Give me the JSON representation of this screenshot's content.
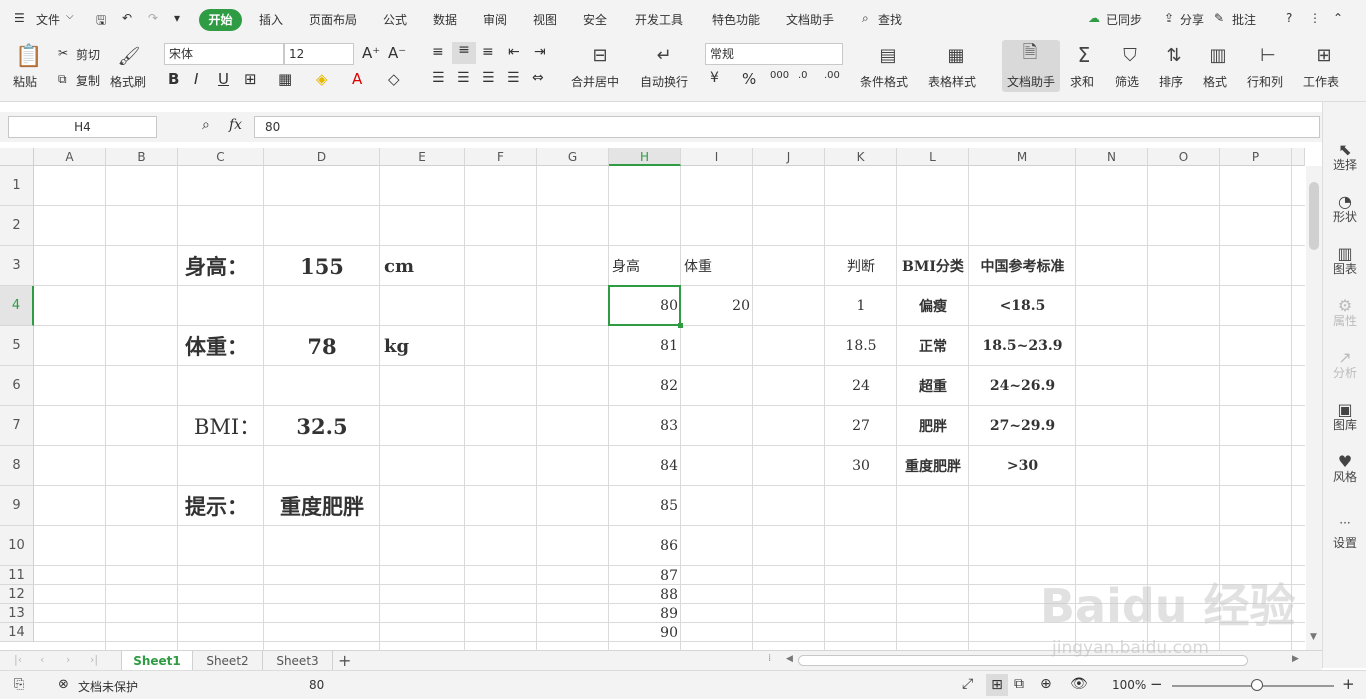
{
  "menubar": {
    "file": "文件",
    "tabs": [
      "开始",
      "插入",
      "页面布局",
      "公式",
      "数据",
      "审阅",
      "视图",
      "安全",
      "开发工具",
      "特色功能",
      "文档助手"
    ],
    "search": "查找",
    "synced": "已同步",
    "share": "分享",
    "comment": "批注"
  },
  "ribbon": {
    "paste": "粘贴",
    "cut": "剪切",
    "copy": "复制",
    "format_painter": "格式刷",
    "font_name": "宋体",
    "font_size": "12",
    "merge_center": "合并居中",
    "wrap": "自动换行",
    "number_format": "常规",
    "cond_format": "条件格式",
    "table_style": "表格样式",
    "doc_helper": "文档助手",
    "sum": "求和",
    "filter": "筛选",
    "sort": "排序",
    "format": "格式",
    "row_col": "行和列",
    "worksheet": "工作表"
  },
  "formula": {
    "name_box": "H4",
    "fx": "fx",
    "value": "80"
  },
  "columns": [
    "A",
    "B",
    "C",
    "D",
    "E",
    "F",
    "G",
    "H",
    "I",
    "J",
    "K",
    "L",
    "M",
    "N",
    "O",
    "P"
  ],
  "rows": [
    "1",
    "2",
    "3",
    "4",
    "5",
    "6",
    "7",
    "8",
    "9",
    "10",
    "11",
    "12",
    "13",
    "14"
  ],
  "cells": {
    "c3": "身高：",
    "d3": "155",
    "e3": "cm",
    "c5": "体重：",
    "d5": "78",
    "e5": "kg",
    "c7": "BMI：",
    "d7": "32.5",
    "c9": "提示：",
    "d9": "重度肥胖",
    "h3": "身高",
    "i3": "体重",
    "h_values": [
      "80",
      "81",
      "82",
      "83",
      "84",
      "85",
      "86",
      "87",
      "88",
      "89",
      "90"
    ],
    "i4": "20",
    "k3": "判断",
    "l3": "BMI分类",
    "m3": "中国参考标准",
    "k_values": [
      "1",
      "18.5",
      "24",
      "27",
      "30"
    ],
    "l_values": [
      "偏瘦",
      "正常",
      "超重",
      "肥胖",
      "重度肥胖"
    ],
    "m_values": [
      "<18.5",
      "18.5~23.9",
      "24~26.9",
      "27~29.9",
      ">30"
    ]
  },
  "side_panel": [
    "选择",
    "形状",
    "图表",
    "属性",
    "分析",
    "图库",
    "风格",
    "设置"
  ],
  "sheets": [
    "Sheet1",
    "Sheet2",
    "Sheet3"
  ],
  "status": {
    "protect": "文档未保护",
    "value": "80",
    "zoom": "100%"
  },
  "watermark": "Baidu 经验",
  "watermark_url": "jingyan.baidu.com",
  "colors": {
    "accent": "#2f9c44"
  }
}
